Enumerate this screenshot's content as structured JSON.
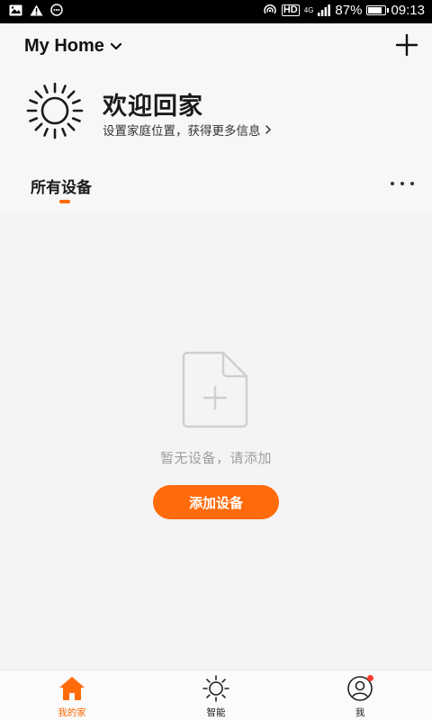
{
  "status_bar": {
    "battery": "87%",
    "time": "09:13",
    "network": "4G",
    "hd_label": "HD",
    "battery_level": 0.87,
    "icons": [
      "image-icon",
      "warning-icon",
      "message-icon",
      "hotspot-icon",
      "hd-icon",
      "signal-icon",
      "battery-icon"
    ]
  },
  "header": {
    "home_name": "My Home",
    "home_icon": "chevron-down-icon",
    "add_icon": "plus-icon"
  },
  "welcome": {
    "title": "欢迎回家",
    "subtitle": "设置家庭位置，获得更多信息",
    "icon": "sun-icon"
  },
  "tabs": {
    "active_label": "所有设备",
    "more_icon": "more-icon"
  },
  "empty_state": {
    "message": "暂无设备，请添加",
    "button_label": "添加设备",
    "icon": "add-file-icon"
  },
  "bottom_nav": {
    "items": [
      {
        "label": "我的家",
        "icon": "home-icon",
        "active": true
      },
      {
        "label": "智能",
        "icon": "sun-icon",
        "active": false
      },
      {
        "label": "我",
        "icon": "user-icon",
        "active": false,
        "badge": true
      }
    ]
  },
  "colors": {
    "accent": "#ff6a0a",
    "badge": "#ff3b30",
    "background": "#f4f4f4",
    "muted_text": "#9e9e9e"
  }
}
